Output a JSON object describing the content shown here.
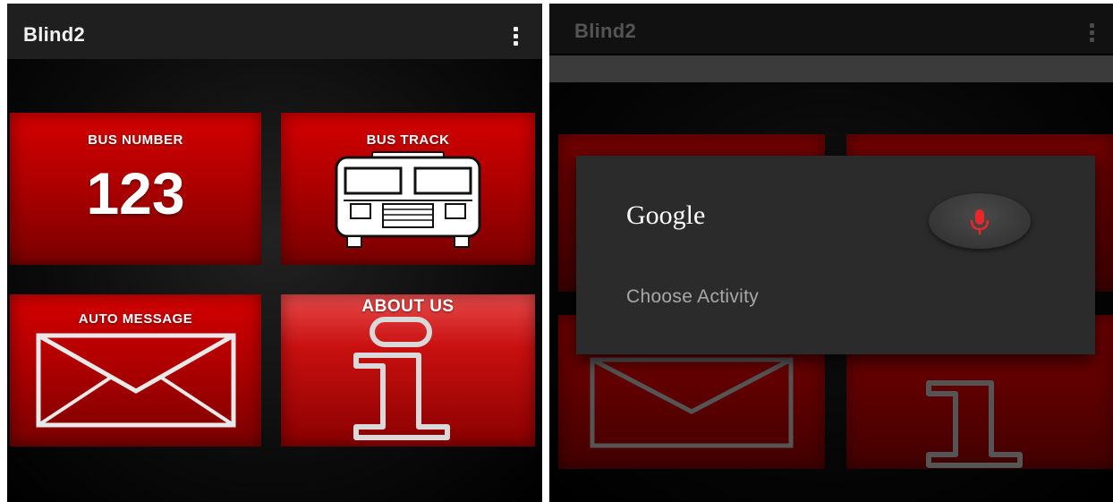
{
  "left_screen": {
    "app_title": "Blind2",
    "tiles": {
      "bus_number": {
        "label": "BUS NUMBER",
        "value": "123"
      },
      "bus_track": {
        "label": "BUS TRACK",
        "icon": "bus-icon"
      },
      "auto_message": {
        "label": "AUTO MESSAGE",
        "icon": "envelope-icon"
      },
      "about_us": {
        "label": "ABOUT US",
        "icon": "info-icon"
      }
    }
  },
  "right_screen": {
    "app_title": "Blind2",
    "dialog": {
      "provider": "Google",
      "prompt": "Choose Activity",
      "mic_icon": "microphone-icon"
    }
  },
  "colors": {
    "tile_red": "#c80000",
    "app_bar": "#1f1f1f",
    "dialog_bg": "#2b2b2b",
    "mic_red": "#e8262b"
  }
}
